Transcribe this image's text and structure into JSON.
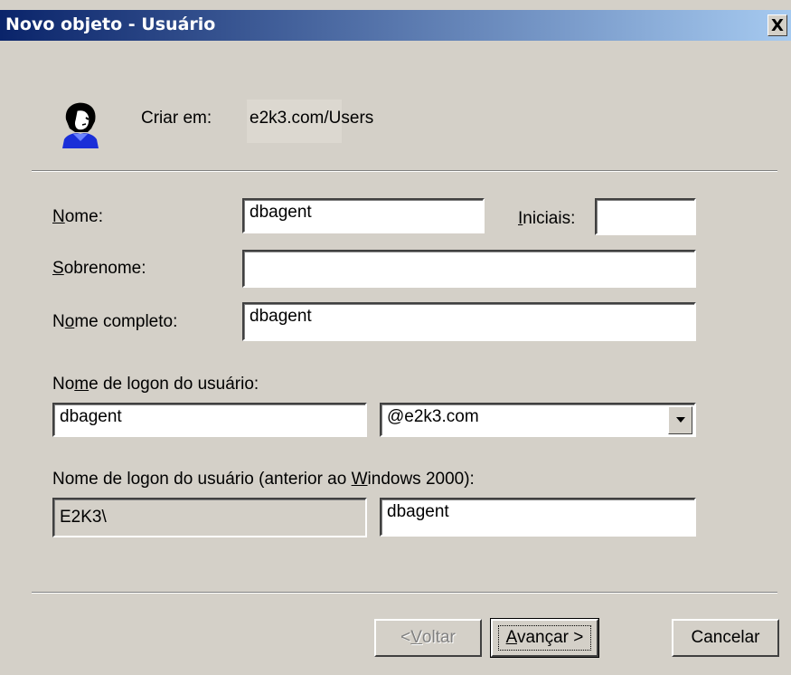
{
  "window": {
    "title": "Novo objeto - Usuário",
    "close": "X"
  },
  "header": {
    "create_in_label": "Criar em:",
    "create_in_value": "e2k3.com/Users",
    "icon": "user-icon"
  },
  "form": {
    "first_name": {
      "label_accel": "N",
      "label_rest": "ome:",
      "value": "dbagent"
    },
    "initials": {
      "label_accel": "I",
      "label_rest": "niciais:",
      "value": ""
    },
    "last_name": {
      "label_accel": "S",
      "label_rest": "obrenome:",
      "value": ""
    },
    "full_name": {
      "label_pre": "N",
      "label_accel": "o",
      "label_rest": "me completo:",
      "value": "dbagent"
    },
    "logon_name": {
      "label_pre": "No",
      "label_accel": "m",
      "label_rest": "e de logon do usuário:",
      "value": "dbagent",
      "domain_selected": "@e2k3.com"
    },
    "pre2000": {
      "label_pre": "Nome de logon do usuário (anterior ao ",
      "label_accel": "W",
      "label_rest": "indows 2000):",
      "domain": "E2K3\\",
      "value": "dbagent"
    }
  },
  "buttons": {
    "back": {
      "pre": "< ",
      "accel": "V",
      "rest": "oltar"
    },
    "next": {
      "accel": "A",
      "rest": "vançar >"
    },
    "cancel": {
      "label": "Cancelar"
    }
  }
}
